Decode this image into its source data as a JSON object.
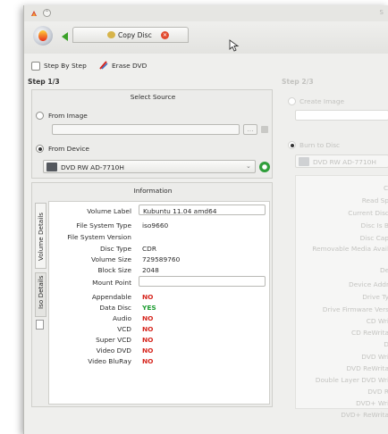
{
  "titlebar": {
    "title_fragment": "S"
  },
  "toolbar": {
    "tab_label": "Copy Disc"
  },
  "options": {
    "step_by_step": "Step By Step",
    "erase_dvd": "Erase DVD"
  },
  "step1": {
    "title": "Step 1/3",
    "select_source": "Select Source",
    "from_image": "From Image",
    "from_device": "From Device",
    "device_value": "DVD RW AD-7710H",
    "information_title": "Information",
    "tabs": [
      "Volume Details",
      "Iso Details"
    ],
    "rows": [
      {
        "label": "Volume Label",
        "value": "Kubuntu 11.04 amd64",
        "style": "box"
      },
      {
        "label": "File System Type",
        "value": "iso9660",
        "style": "plain"
      },
      {
        "label": "File System Version",
        "value": "",
        "style": "plain"
      },
      {
        "label": "Disc Type",
        "value": "CDR",
        "style": "plain"
      },
      {
        "label": "Volume Size",
        "value": "729589760",
        "style": "plain"
      },
      {
        "label": "Block Size",
        "value": "2048",
        "style": "plain"
      },
      {
        "label": "Mount Point",
        "value": "",
        "style": "box"
      },
      {
        "label": "Appendable",
        "value": "NO",
        "style": "red"
      },
      {
        "label": "Data Disc",
        "value": "YES",
        "style": "green"
      },
      {
        "label": "Audio",
        "value": "NO",
        "style": "red"
      },
      {
        "label": "VCD",
        "value": "NO",
        "style": "red"
      },
      {
        "label": "Super VCD",
        "value": "NO",
        "style": "red"
      },
      {
        "label": "Video DVD",
        "value": "NO",
        "style": "red"
      },
      {
        "label": "Video BluRay",
        "value": "NO",
        "style": "red"
      }
    ]
  },
  "step2": {
    "title": "Step 2/3",
    "create_image": "Create Image",
    "burn_to_disc": "Burn to Disc",
    "device_value": "DVD RW AD-7710H",
    "section_marker_1": "C",
    "labels_a": [
      "Read Sp",
      "Current Disc",
      "Disc Is B",
      "Disc Cap",
      "Removable Media Avail"
    ],
    "section_marker_2": "De",
    "labels_b": [
      "Device Addr",
      "Drive Ty",
      "Drive Firmware Vers",
      "CD Wri",
      "CD ReWrita",
      "D",
      "DVD Wri",
      "DVD ReWrita",
      "Double Layer DVD Wri",
      "DVD R",
      "DVD+ Wri",
      "DVD+ ReWrita"
    ]
  },
  "colors": {
    "no": "#d6261e",
    "yes": "#1f9d33",
    "window_bg": "#efefed"
  },
  "icons": [
    "app-burn-logo-icon",
    "back-arrow-icon",
    "disc-icon",
    "close-tab-icon",
    "eraser-icon",
    "drive-icon",
    "refresh-icon",
    "browse-icon",
    "clear-icon",
    "document-icon"
  ]
}
